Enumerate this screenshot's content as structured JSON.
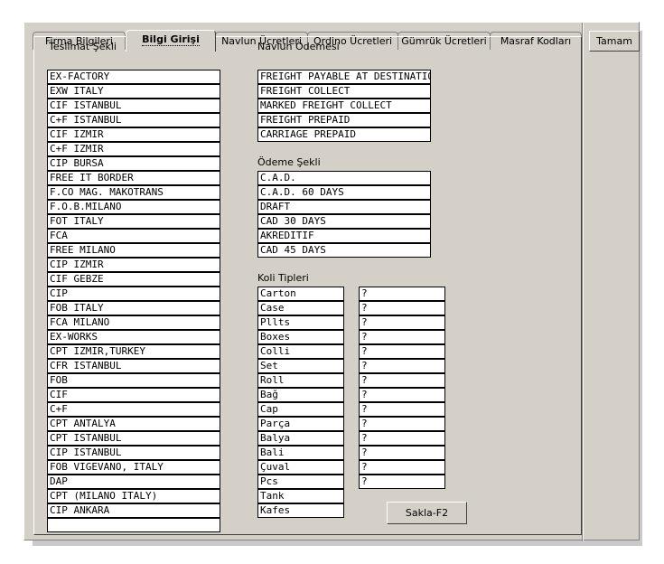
{
  "tabs": [
    "Firma Bilgileri",
    "Bilgi Girişi",
    "Navlun Ücretleri",
    "Ordino Ücretleri",
    "Gümrük Ücretleri",
    "Masraf Kodları"
  ],
  "active_tab": "Bilgi Girişi",
  "buttons": {
    "ok": "Tamam",
    "save": "Sakla-F2"
  },
  "teslimat": {
    "label": "Teslimat Şekli",
    "items": [
      "EX-FACTORY",
      "EXW ITALY",
      "CIF ISTANBUL",
      "C+F ISTANBUL",
      "CIF IZMIR",
      "C+F IZMIR",
      "CIP BURSA",
      "FREE IT BORDER",
      "F.CO MAG. MAKOTRANS",
      "F.O.B.MILANO",
      "FOT ITALY",
      "FCA",
      "FREE MILANO",
      "CIP IZMIR",
      "CIF GEBZE",
      "CIP",
      "FOB ITALY",
      "FCA MILANO",
      "EX-WORKS",
      "CPT IZMIR,TURKEY",
      "CFR ISTANBUL",
      "FOB",
      "CIF",
      "C+F",
      "CPT ANTALYA",
      "CPT ISTANBUL",
      "CIP ISTANBUL",
      "FOB VIGEVANO, ITALY",
      "DAP",
      "CPT (MILANO ITALY)",
      "CIP ANKARA",
      ""
    ]
  },
  "navlun_odemesi": {
    "label": "Navlun Ödemesi",
    "items": [
      "FREIGHT PAYABLE AT DESTINATION",
      "FREIGHT COLLECT",
      "MARKED FREIGHT COLLECT",
      "FREIGHT PREPAID",
      "CARRIAGE PREPAID"
    ]
  },
  "odeme_sekli": {
    "label": "Ödeme Şekli",
    "items": [
      "C.A.D.",
      "C.A.D. 60 DAYS",
      "DRAFT",
      "CAD 30 DAYS",
      "AKREDITIF",
      "CAD 45 DAYS"
    ]
  },
  "koli_tipleri": {
    "label": "Koli Tipleri",
    "names": [
      "Carton",
      "Case",
      "Pllts",
      "Boxes",
      "Colli",
      "Set",
      "Roll",
      "Bağ",
      "Cap",
      "Parça",
      "Balya",
      "Bali",
      "Çuval",
      "Pcs",
      "Tank",
      "Kafes"
    ],
    "codes": [
      "?",
      "?",
      "?",
      "?",
      "?",
      "?",
      "?",
      "?",
      "?",
      "?",
      "?",
      "?",
      "?",
      "?"
    ]
  }
}
